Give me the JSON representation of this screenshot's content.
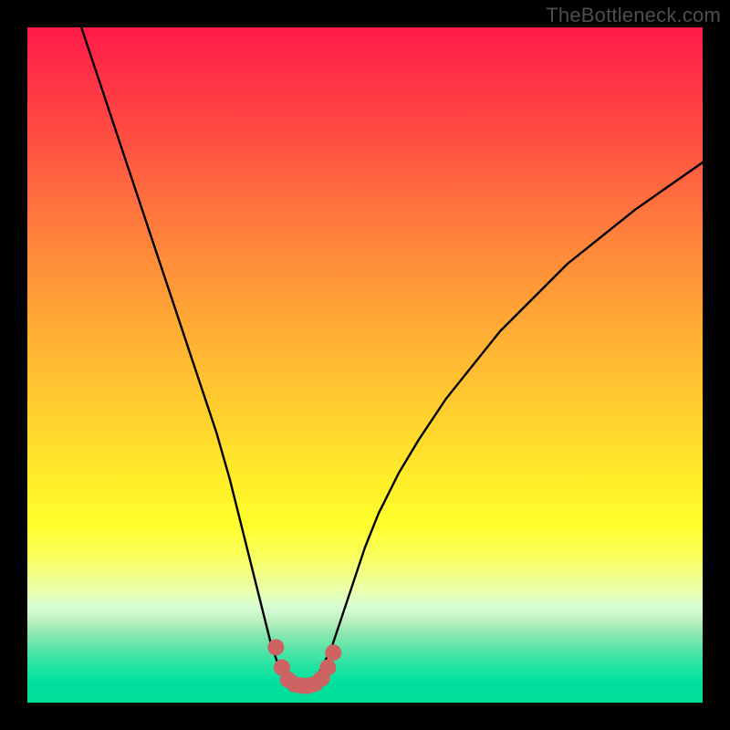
{
  "watermark": "TheBottleneck.com",
  "chart_data": {
    "type": "line",
    "title": "",
    "xlabel": "",
    "ylabel": "",
    "xlim": [
      0,
      100
    ],
    "ylim": [
      0,
      100
    ],
    "series": [
      {
        "name": "bottleneck-curve",
        "color": "#000000",
        "x": [
          8,
          10,
          12,
          14,
          16,
          18,
          20,
          22,
          24,
          26,
          28,
          30,
          31,
          32,
          33,
          34,
          35,
          36,
          37,
          38,
          39,
          40,
          41,
          42,
          43,
          44,
          45,
          46,
          48,
          50,
          52,
          55,
          58,
          62,
          66,
          70,
          75,
          80,
          85,
          90,
          95,
          100
        ],
        "y": [
          100,
          94,
          88,
          82,
          76,
          70,
          64,
          58,
          52,
          46,
          40,
          33,
          29,
          25,
          21,
          17,
          13,
          9,
          6,
          4,
          3,
          2.5,
          2.5,
          3,
          4,
          6,
          8,
          11,
          17,
          23,
          28,
          34,
          39,
          45,
          50,
          55,
          60,
          65,
          69,
          73,
          76.5,
          80
        ]
      },
      {
        "name": "optimal-zone-markers",
        "color": "#ce6363",
        "marker_radius": 9,
        "x": [
          36.8,
          37.7,
          38.6,
          39.6,
          40.6,
          41.6,
          42.6,
          43.6,
          44.5,
          45.3
        ],
        "y": [
          8.2,
          5.2,
          3.4,
          2.7,
          2.5,
          2.5,
          2.8,
          3.6,
          5.2,
          7.4
        ]
      }
    ]
  }
}
